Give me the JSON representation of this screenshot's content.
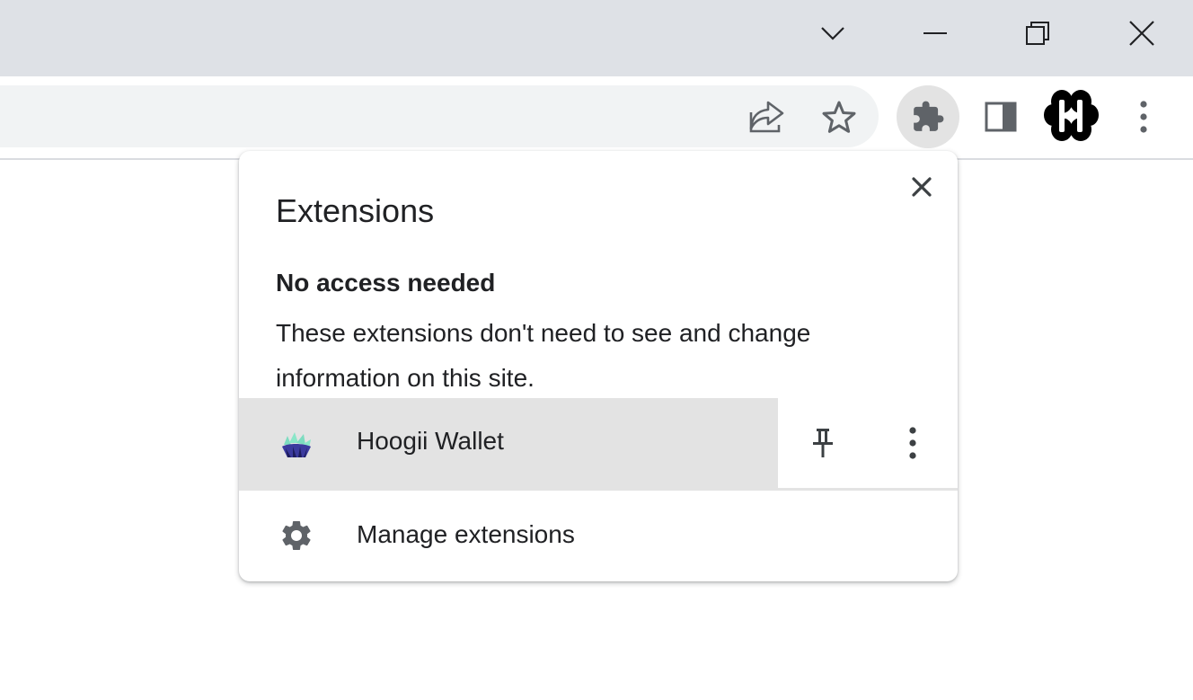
{
  "window": {
    "controls": [
      "tab-search-icon",
      "minimize-icon",
      "restore-icon",
      "close-icon"
    ]
  },
  "toolbar": {
    "icons": [
      "share-icon",
      "bookmark-star-icon",
      "extensions-puzzle-icon",
      "side-panel-icon",
      "avatar",
      "kebab-menu-icon"
    ]
  },
  "popup": {
    "title": "Extensions",
    "section_heading": "No access needed",
    "section_description": "These extensions don't need to see and change information on this site.",
    "extensions": [
      {
        "name": "Hoogii Wallet"
      }
    ],
    "manage_label": "Manage extensions"
  },
  "colors": {
    "titlebar_bg": "#dee1e6",
    "omnibox_bg": "#f1f3f4",
    "hover_bg": "#e3e3e3",
    "icon_gray": "#5f6368",
    "text": "#202124"
  }
}
